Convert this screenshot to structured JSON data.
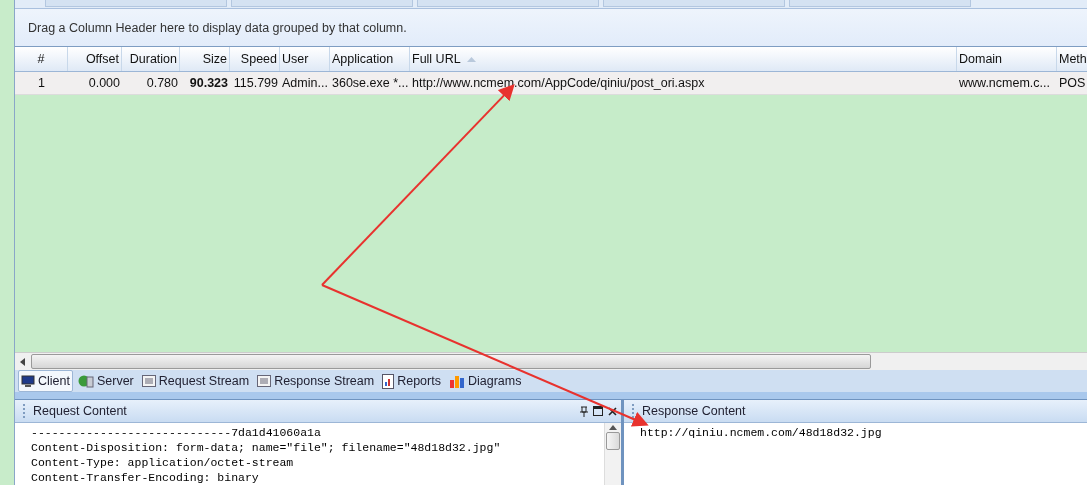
{
  "group_bar": {
    "hint": "Drag a Column Header here to display data grouped by that column."
  },
  "table": {
    "columns": [
      {
        "label": "#",
        "sorted": false
      },
      {
        "label": "Offset",
        "sorted": false
      },
      {
        "label": "Duration",
        "sorted": false
      },
      {
        "label": "Size",
        "sorted": false
      },
      {
        "label": "Speed",
        "sorted": false
      },
      {
        "label": "User",
        "sorted": false
      },
      {
        "label": "Application",
        "sorted": false
      },
      {
        "label": "Full URL",
        "sorted": true
      },
      {
        "label": "Domain",
        "sorted": false
      },
      {
        "label": "Meth"
      }
    ],
    "rows": [
      {
        "cells": [
          "1",
          "0.000",
          "0.780",
          "**90.323**",
          "115.799",
          "Admin...",
          "360se.exe *...",
          "http://www.ncmem.com/AppCode/qiniu/post_ori.aspx",
          "www.ncmem.c...",
          "POS"
        ]
      }
    ]
  },
  "tabs": [
    {
      "label": "Client",
      "selected": true
    },
    {
      "label": "Server",
      "selected": false
    },
    {
      "label": "Request Stream",
      "selected": false
    },
    {
      "label": "Response Stream",
      "selected": false
    },
    {
      "label": "Reports",
      "selected": false
    },
    {
      "label": "Diagrams",
      "selected": false
    }
  ],
  "request_panel": {
    "title": "Request Content",
    "lines": [
      "-----------------------------7da1d41060a1a",
      "Content-Disposition: form-data; name=\"file\"; filename=\"48d18d32.jpg\"",
      "Content-Type: application/octet-stream",
      "Content-Transfer-Encoding: binary"
    ]
  },
  "response_panel": {
    "title": "Response Content",
    "lines": [
      "http://qiniu.ncmem.com/48d18d32.jpg"
    ]
  }
}
